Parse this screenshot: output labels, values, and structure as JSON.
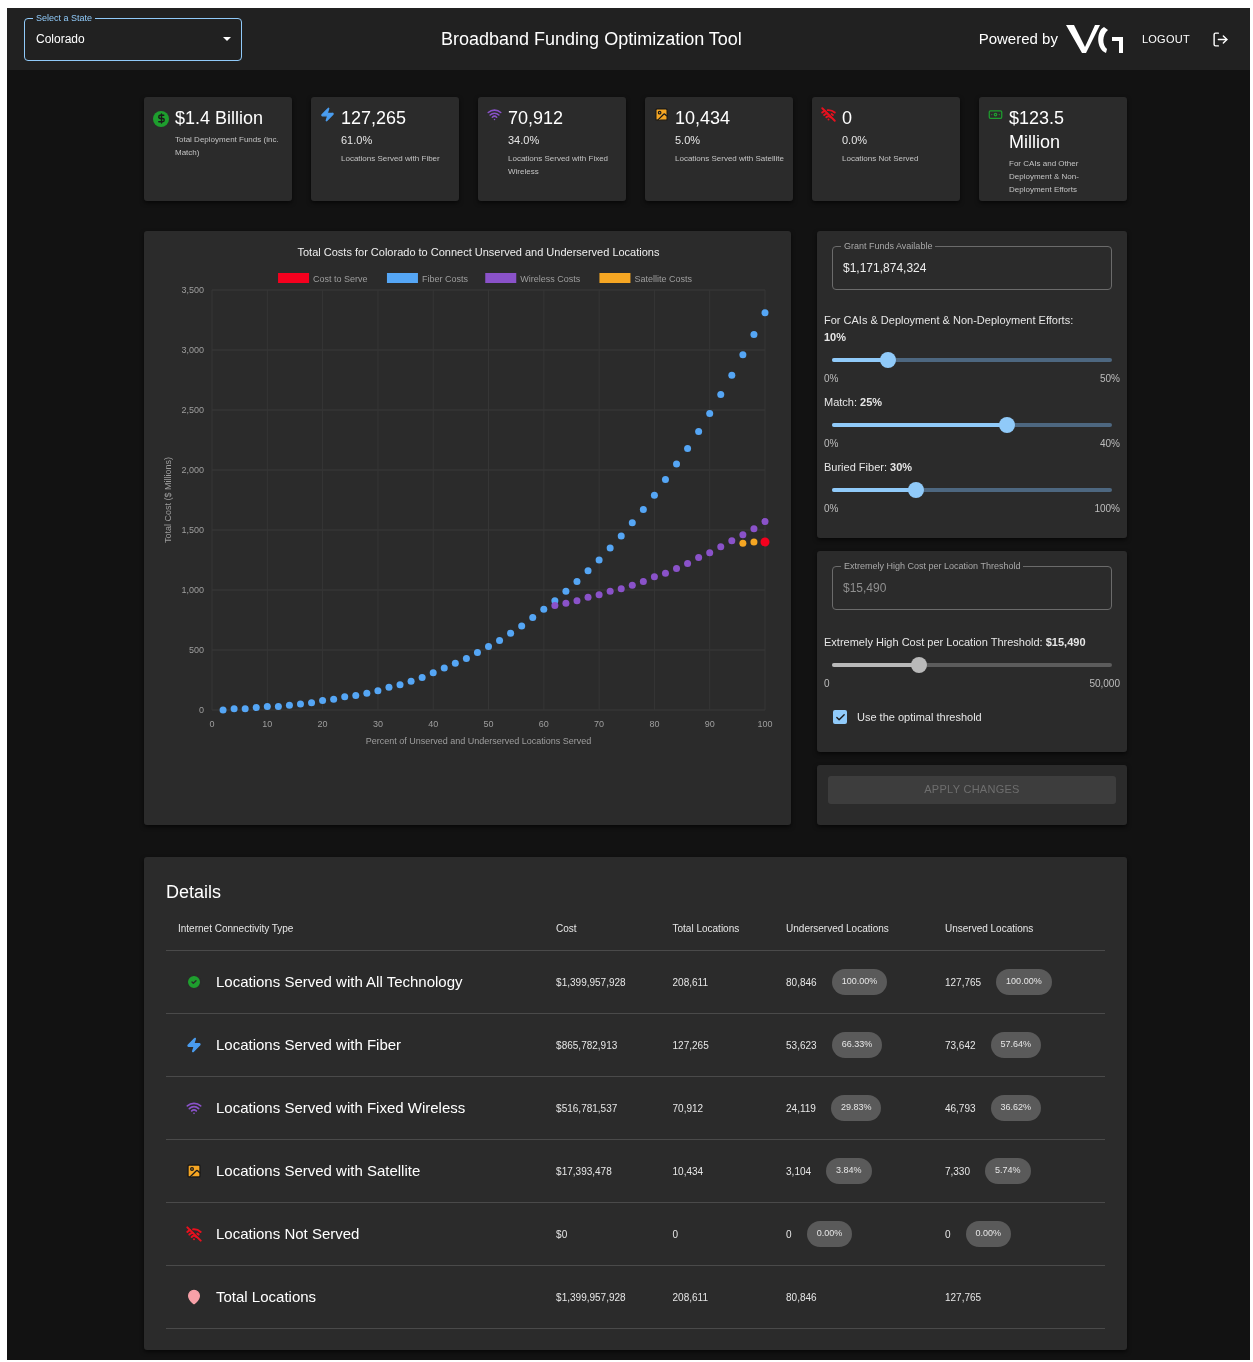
{
  "header": {
    "state_select": {
      "label": "Select a State",
      "value": "Colorado"
    },
    "title": "Broadband Funding Optimization Tool",
    "powered_by": "Powered by",
    "logout": "LOGOUT"
  },
  "cards": [
    {
      "kind": "funds",
      "value": "$1.4 Billion",
      "caption": "Total Deployment Funds (inc. Match)"
    },
    {
      "kind": "fiber",
      "value": "127,265",
      "percent": "61.0%",
      "caption": "Locations Served with Fiber"
    },
    {
      "kind": "wireless",
      "value": "70,912",
      "percent": "34.0%",
      "caption": "Locations Served with Fixed Wireless"
    },
    {
      "kind": "satellite",
      "value": "10,434",
      "percent": "5.0%",
      "caption": "Locations Served with Satellite"
    },
    {
      "kind": "not_served",
      "value": "0",
      "percent": "0.0%",
      "caption": "Locations Not Served"
    },
    {
      "kind": "cais",
      "value": "$123.5 Million",
      "caption": "For CAIs and Other Deployment & Non-Deployment Efforts"
    }
  ],
  "chart": {
    "chart_data": {
      "type": "scatter",
      "grid": true,
      "legend": "top",
      "title": "Total Costs for Colorado to Connect Unserved and Underserved Locations",
      "xlabel": "Percent of Unserved and Underserved Locations Served",
      "ylabel": "Total Cost ($ Millions)",
      "xlim": [
        0,
        100
      ],
      "ylim": [
        0,
        3500
      ],
      "xticks": [
        0,
        10,
        20,
        30,
        40,
        50,
        60,
        70,
        80,
        90,
        100
      ],
      "yticks": [
        {
          "value": 0,
          "label": "0"
        },
        {
          "value": 500,
          "label": "500"
        },
        {
          "value": 1000,
          "label": "1,000"
        },
        {
          "value": 1500,
          "label": "1,500"
        },
        {
          "value": 2000,
          "label": "2,000"
        },
        {
          "value": 2500,
          "label": "2,500"
        },
        {
          "value": 3000,
          "label": "3,000"
        },
        {
          "value": 3500,
          "label": "3,500"
        }
      ],
      "x": [
        2,
        4,
        6,
        8,
        10,
        12,
        14,
        16,
        18,
        20,
        22,
        24,
        26,
        28,
        30,
        32,
        34,
        36,
        38,
        40,
        42,
        44,
        46,
        48,
        50,
        52,
        54,
        56,
        58,
        60,
        62,
        64,
        66,
        68,
        70,
        72,
        74,
        76,
        78,
        80,
        82,
        84,
        86,
        88,
        90,
        92,
        94,
        96,
        98,
        100
      ],
      "series": [
        {
          "name": "Cost to Serve",
          "color": "#f5001e",
          "values": [
            null,
            null,
            null,
            null,
            null,
            null,
            null,
            null,
            null,
            null,
            null,
            null,
            null,
            null,
            null,
            null,
            null,
            null,
            null,
            null,
            null,
            null,
            null,
            null,
            null,
            null,
            null,
            null,
            null,
            null,
            null,
            null,
            null,
            null,
            null,
            null,
            null,
            null,
            null,
            null,
            null,
            null,
            null,
            null,
            null,
            null,
            null,
            null,
            null,
            1400
          ]
        },
        {
          "name": "Fiber Costs",
          "color": "#55a6f5",
          "values": [
            0,
            10,
            10,
            20,
            30,
            30,
            40,
            50,
            60,
            80,
            90,
            110,
            120,
            140,
            160,
            190,
            210,
            240,
            270,
            310,
            350,
            390,
            430,
            480,
            530,
            580,
            640,
            700,
            770,
            840,
            910,
            990,
            1070,
            1160,
            1250,
            1350,
            1450,
            1560,
            1670,
            1790,
            1920,
            2050,
            2180,
            2320,
            2470,
            2630,
            2790,
            2960,
            3130,
            3310
          ]
        },
        {
          "name": "Wireless Costs",
          "color": "#8a52c9",
          "values": [
            null,
            null,
            null,
            null,
            null,
            null,
            null,
            null,
            null,
            null,
            null,
            null,
            null,
            null,
            null,
            null,
            null,
            null,
            null,
            null,
            null,
            null,
            null,
            null,
            null,
            null,
            null,
            null,
            null,
            null,
            870,
            890,
            910,
            940,
            960,
            990,
            1010,
            1040,
            1070,
            1110,
            1140,
            1180,
            1220,
            1270,
            1310,
            1360,
            1410,
            1460,
            1510,
            1570
          ]
        },
        {
          "name": "Satellite Costs",
          "color": "#f5a623",
          "values": [
            null,
            null,
            null,
            null,
            null,
            null,
            null,
            null,
            null,
            null,
            null,
            null,
            null,
            null,
            null,
            null,
            null,
            null,
            null,
            null,
            null,
            null,
            null,
            null,
            null,
            null,
            null,
            null,
            null,
            null,
            null,
            null,
            null,
            null,
            null,
            null,
            null,
            null,
            null,
            null,
            null,
            null,
            null,
            null,
            null,
            null,
            null,
            1390,
            1400,
            null
          ]
        }
      ]
    }
  },
  "funding_panel": {
    "field": {
      "label": "Grant Funds Available",
      "value": "$1,171,874,324"
    },
    "sliders": [
      {
        "label": "For CAIs & Deployment & Non-Deployment Efforts: **10%**",
        "level": 0.2,
        "min": "0%",
        "max": "50%"
      },
      {
        "label": "Match: **25%**",
        "level": 0.625,
        "min": "0%",
        "max": "40%"
      },
      {
        "label": "Buried Fiber: **30%**",
        "level": 0.3,
        "min": "0%",
        "max": "100%"
      }
    ]
  },
  "threshold_panel": {
    "field": {
      "label": "Extremely High Cost per Location Threshold",
      "value": "$15,490",
      "disabled": true
    },
    "slider": {
      "label": "Extremely High Cost per Location Threshold: **$15,490**",
      "level": 0.31,
      "min": "0",
      "max": "50,000",
      "disabled": true
    },
    "checkbox": {
      "label": "Use the optimal threshold",
      "checked": true
    }
  },
  "apply_button": {
    "label": "APPLY CHANGES",
    "disabled": true
  },
  "details": {
    "title": "Details",
    "columns": [
      "Internet Connectivity Type",
      "Cost",
      "Total Locations",
      "Underserved Locations",
      "Unserved Locations"
    ],
    "rows": [
      {
        "kind": "all",
        "type": "Locations Served with All Technology",
        "cost": "$1,399,957,928",
        "total": "208,611",
        "underserved": "80,846",
        "underserved_pct": "100.00%",
        "unserved": "127,765",
        "unserved_pct": "100.00%"
      },
      {
        "kind": "fiber",
        "type": "Locations Served with Fiber",
        "cost": "$865,782,913",
        "total": "127,265",
        "underserved": "53,623",
        "underserved_pct": "66.33%",
        "unserved": "73,642",
        "unserved_pct": "57.64%"
      },
      {
        "kind": "wireless",
        "type": "Locations Served with Fixed Wireless",
        "cost": "$516,781,537",
        "total": "70,912",
        "underserved": "24,119",
        "underserved_pct": "29.83%",
        "unserved": "46,793",
        "unserved_pct": "36.62%"
      },
      {
        "kind": "satellite",
        "type": "Locations Served with Satellite",
        "cost": "$17,393,478",
        "total": "10,434",
        "underserved": "3,104",
        "underserved_pct": "3.84%",
        "unserved": "7,330",
        "unserved_pct": "5.74%"
      },
      {
        "kind": "not_served",
        "type": "Locations Not Served",
        "cost": "$0",
        "total": "0",
        "underserved": "0",
        "underserved_pct": "0.00%",
        "unserved": "0",
        "unserved_pct": "0.00%"
      },
      {
        "kind": "total",
        "type": "Total Locations",
        "cost": "$1,399,957,928",
        "total": "208,611",
        "underserved": "80,846",
        "unserved": "127,765"
      }
    ]
  }
}
